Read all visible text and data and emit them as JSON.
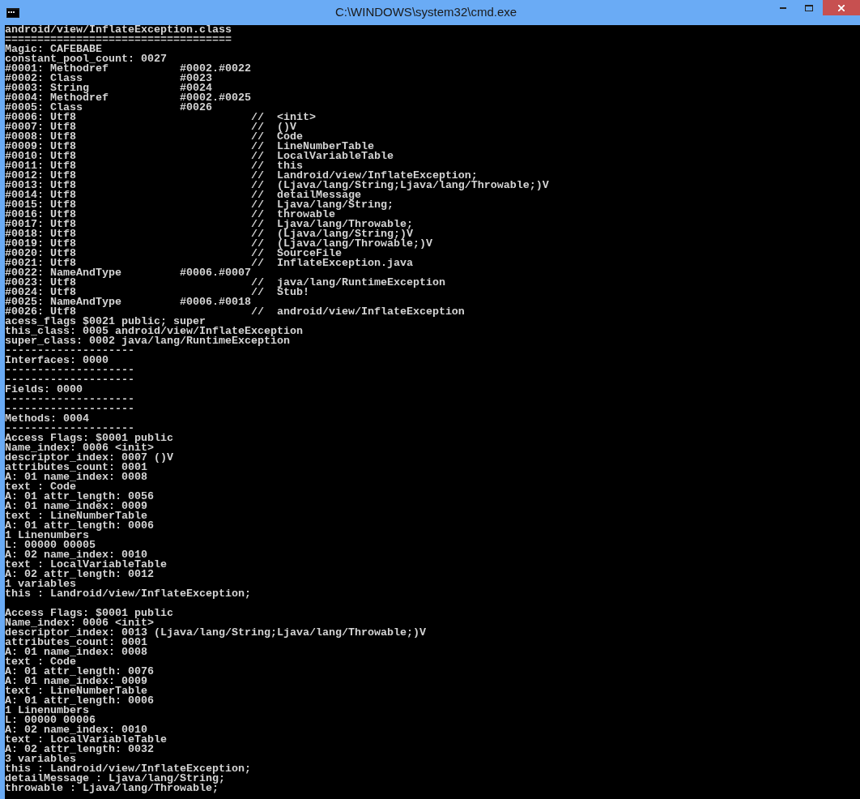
{
  "window": {
    "title": "C:\\WINDOWS\\system32\\cmd.exe"
  },
  "header": [
    "android/view/InflateException.class",
    "===================================",
    "Magic: CAFEBABE",
    "constant_pool_count: 0027"
  ],
  "constant_pool": [
    {
      "entry": "#0001: Methodref",
      "ref": "#0002.#0022"
    },
    {
      "entry": "#0002: Class",
      "ref": "#0023"
    },
    {
      "entry": "#0003: String",
      "ref": "#0024"
    },
    {
      "entry": "#0004: Methodref",
      "ref": "#0002.#0025"
    },
    {
      "entry": "#0005: Class",
      "ref": "#0026"
    },
    {
      "entry": "#0006: Utf8",
      "comment": "//  <init>"
    },
    {
      "entry": "#0007: Utf8",
      "comment": "//  ()V"
    },
    {
      "entry": "#0008: Utf8",
      "comment": "//  Code"
    },
    {
      "entry": "#0009: Utf8",
      "comment": "//  LineNumberTable"
    },
    {
      "entry": "#0010: Utf8",
      "comment": "//  LocalVariableTable"
    },
    {
      "entry": "#0011: Utf8",
      "comment": "//  this"
    },
    {
      "entry": "#0012: Utf8",
      "comment": "//  Landroid/view/InflateException;"
    },
    {
      "entry": "#0013: Utf8",
      "comment": "//  (Ljava/lang/String;Ljava/lang/Throwable;)V"
    },
    {
      "entry": "#0014: Utf8",
      "comment": "//  detailMessage"
    },
    {
      "entry": "#0015: Utf8",
      "comment": "//  Ljava/lang/String;"
    },
    {
      "entry": "#0016: Utf8",
      "comment": "//  throwable"
    },
    {
      "entry": "#0017: Utf8",
      "comment": "//  Ljava/lang/Throwable;"
    },
    {
      "entry": "#0018: Utf8",
      "comment": "//  (Ljava/lang/String;)V"
    },
    {
      "entry": "#0019: Utf8",
      "comment": "//  (Ljava/lang/Throwable;)V"
    },
    {
      "entry": "#0020: Utf8",
      "comment": "//  SourceFile"
    },
    {
      "entry": "#0021: Utf8",
      "comment": "//  InflateException.java"
    },
    {
      "entry": "#0022: NameAndType",
      "ref": "#0006.#0007"
    },
    {
      "entry": "#0023: Utf8",
      "comment": "//  java/lang/RuntimeException"
    },
    {
      "entry": "#0024: Utf8",
      "comment": "//  Stub!"
    },
    {
      "entry": "#0025: NameAndType",
      "ref": "#0006.#0018"
    },
    {
      "entry": "#0026: Utf8",
      "comment": "//  android/view/InflateException"
    }
  ],
  "blocks": [
    [
      "acess_flags $0021 public; super",
      "this_class: 0005 android/view/InflateException",
      "super_class: 0002 java/lang/RuntimeException",
      "--------------------",
      "Interfaces: 0000",
      "--------------------",
      "--------------------",
      "Fields: 0000",
      "--------------------",
      "--------------------",
      "Methods: 0004",
      "--------------------",
      "Access Flags: $0001 public",
      "Name_index: 0006 <init>",
      "descriptor_index: 0007 ()V",
      "attributes_count: 0001",
      "A: 01 name_index: 0008",
      "text : Code",
      "A: 01 attr_length: 0056",
      "A: 01 name_index: 0009",
      "text : LineNumberTable",
      "A: 01 attr_length: 0006",
      "1 Linenumbers",
      "L: 00000 00005",
      "A: 02 name_index: 0010",
      "text : LocalVariableTable",
      "A: 02 attr_length: 0012",
      "1 variables",
      "this : Landroid/view/InflateException;"
    ],
    [
      "Access Flags: $0001 public",
      "Name_index: 0006 <init>",
      "descriptor_index: 0013 (Ljava/lang/String;Ljava/lang/Throwable;)V",
      "attributes_count: 0001",
      "A: 01 name_index: 0008",
      "text : Code",
      "A: 01 attr_length: 0076",
      "A: 01 name_index: 0009",
      "text : LineNumberTable",
      "A: 01 attr_length: 0006",
      "1 Linenumbers",
      "L: 00000 00006",
      "A: 02 name_index: 0010",
      "text : LocalVariableTable",
      "A: 02 attr_length: 0032",
      "3 variables",
      "this : Landroid/view/InflateException;",
      "detailMessage : Ljava/lang/String;",
      "throwable : Ljava/lang/Throwable;"
    ]
  ]
}
